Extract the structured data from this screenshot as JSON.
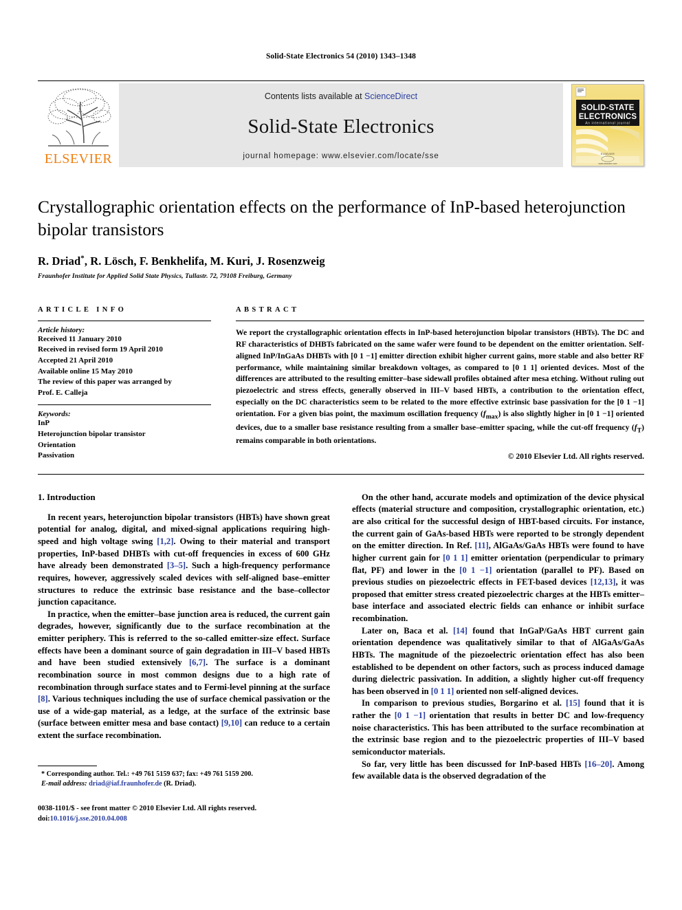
{
  "running_head": "Solid-State Electronics 54 (2010) 1343–1348",
  "masthead": {
    "elsevier_wordmark": "ELSEVIER",
    "contents_prefix": "Contents lists available at ",
    "contents_link": "ScienceDirect",
    "journal_name": "Solid-State Electronics",
    "homepage": "journal homepage: www.elsevier.com/locate/sse",
    "cover": {
      "title_line1": "SOLID-STATE",
      "title_line2": "ELECTRONICS",
      "subtitle": "An international journal",
      "publisher": "ELSEVIER",
      "url": "www.elsevier.com",
      "accent_color": "#f2d96b",
      "band_color": "#111111"
    }
  },
  "article": {
    "title": "Crystallographic orientation effects on the performance of InP-based heterojunction bipolar transistors",
    "authors": "R. Driad, R. Lösch, F. Benkhelifa, M. Kuri, J. Rosenzweig",
    "corresponding_marker": "*",
    "affiliation": "Fraunhofer Institute for Applied Solid State Physics, Tullastr. 72, 79108 Freiburg, Germany"
  },
  "article_info": {
    "heading": "ARTICLE INFO",
    "history_label": "Article history:",
    "history": [
      "Received 11 January 2010",
      "Received in revised form 19 April 2010",
      "Accepted 21 April 2010",
      "Available online 15 May 2010",
      "The review of this paper was arranged by",
      "Prof. E. Calleja"
    ],
    "keywords_label": "Keywords:",
    "keywords": [
      "InP",
      "Heterojunction bipolar transistor",
      "Orientation",
      "Passivation"
    ]
  },
  "abstract": {
    "heading": "ABSTRACT",
    "text": "We report the crystallographic orientation effects in InP-based heterojunction bipolar transistors (HBTs). The DC and RF characteristics of DHBTs fabricated on the same wafer were found to be dependent on the emitter orientation. Self-aligned InP/InGaAs DHBTs with [0 1 −1] emitter direction exhibit higher current gains, more stable and also better RF performance, while maintaining similar breakdown voltages, as compared to [0 1 1] oriented devices. Most of the differences are attributed to the resulting emitter–base sidewall profiles obtained after mesa etching. Without ruling out piezoelectric and stress effects, generally observed in III–V based HBTs, a contribution to the orientation effect, especially on the DC characteristics seem to be related to the more effective extrinsic base passivation for the [0 1 −1] orientation. For a given bias point, the maximum oscillation frequency (fmax) is also slightly higher in [0 1 −1] oriented devices, due to a smaller base resistance resulting from a smaller base–emitter spacing, while the cut-off frequency (fT) remains comparable in both orientations.",
    "copyright": "© 2010 Elsevier Ltd. All rights reserved."
  },
  "body": {
    "section_number_title": "1. Introduction",
    "left_paragraphs": [
      "In recent years, heterojunction bipolar transistors (HBTs) have shown great potential for analog, digital, and mixed-signal applications requiring high-speed and high voltage swing [1,2]. Owing to their material and transport properties, InP-based DHBTs with cut-off frequencies in excess of 600 GHz have already been demonstrated [3–5]. Such a high-frequency performance requires, however, aggressively scaled devices with self-aligned base–emitter structures to reduce the extrinsic base resistance and the base–collector junction capacitance.",
      "In practice, when the emitter–base junction area is reduced, the current gain degrades, however, significantly due to the surface recombination at the emitter periphery. This is referred to the so-called emitter-size effect. Surface effects have been a dominant source of gain degradation in III–V based HBTs and have been studied extensively [6,7]. The surface is a dominant recombination source in most common designs due to a high rate of recombination through surface states and to Fermi-level pinning at the surface [8]. Various techniques including the use of surface chemical passivation or the use of a wide-gap material, as a ledge, at the surface of the extrinsic base (surface between emitter mesa and base contact) [9,10] can reduce to a certain extent the surface recombination."
    ],
    "right_paragraphs": [
      "On the other hand, accurate models and optimization of the device physical effects (material structure and composition, crystallographic orientation, etc.) are also critical for the successful design of HBT-based circuits. For instance, the current gain of GaAs-based HBTs were reported to be strongly dependent on the emitter direction. In Ref. [11], AlGaAs/GaAs HBTs were found to have higher current gain for [0 1 1] emitter orientation (perpendicular to primary flat, PF) and lower in the [0 1 −1] orientation (parallel to PF). Based on previous studies on piezoelectric effects in FET-based devices [12,13], it was proposed that emitter stress created piezoelectric charges at the HBTs emitter–base interface and associated electric fields can enhance or inhibit surface recombination.",
      "Later on, Baca et al. [14] found that InGaP/GaAs HBT current gain orientation dependence was qualitatively similar to that of AlGaAs/GaAs HBTs. The magnitude of the piezoelectric orientation effect has also been established to be dependent on other factors, such as process induced damage during dielectric passivation. In addition, a slightly higher cut-off frequency has been observed in [0 1 1] oriented non self-aligned devices.",
      "In comparison to previous studies, Borgarino et al. [15] found that it is rather the [0 1 −1] orientation that results in better DC and low-frequency noise characteristics. This has been attributed to the surface recombination at the extrinsic base region and to the piezoelectric properties of III–V based semiconductor materials.",
      "So far, very little has been discussed for InP-based HBTs [16–20]. Among few available data is the observed degradation of the"
    ]
  },
  "footnote": {
    "corresponding": "* Corresponding author. Tel.: +49 761 5159 637; fax: +49 761 5159 200.",
    "email_label": "E-mail address:",
    "email": "driad@iaf.fraunhofer.de",
    "email_owner": "(R. Driad)."
  },
  "imprint": {
    "issn_line": "0038-1101/$ - see front matter © 2010 Elsevier Ltd. All rights reserved.",
    "doi_label": "doi:",
    "doi": "10.1016/j.sse.2010.04.008"
  },
  "colors": {
    "link": "#2b3fa0",
    "elsevier_orange": "#f08010",
    "banner_gray": "#e6e6e6"
  }
}
